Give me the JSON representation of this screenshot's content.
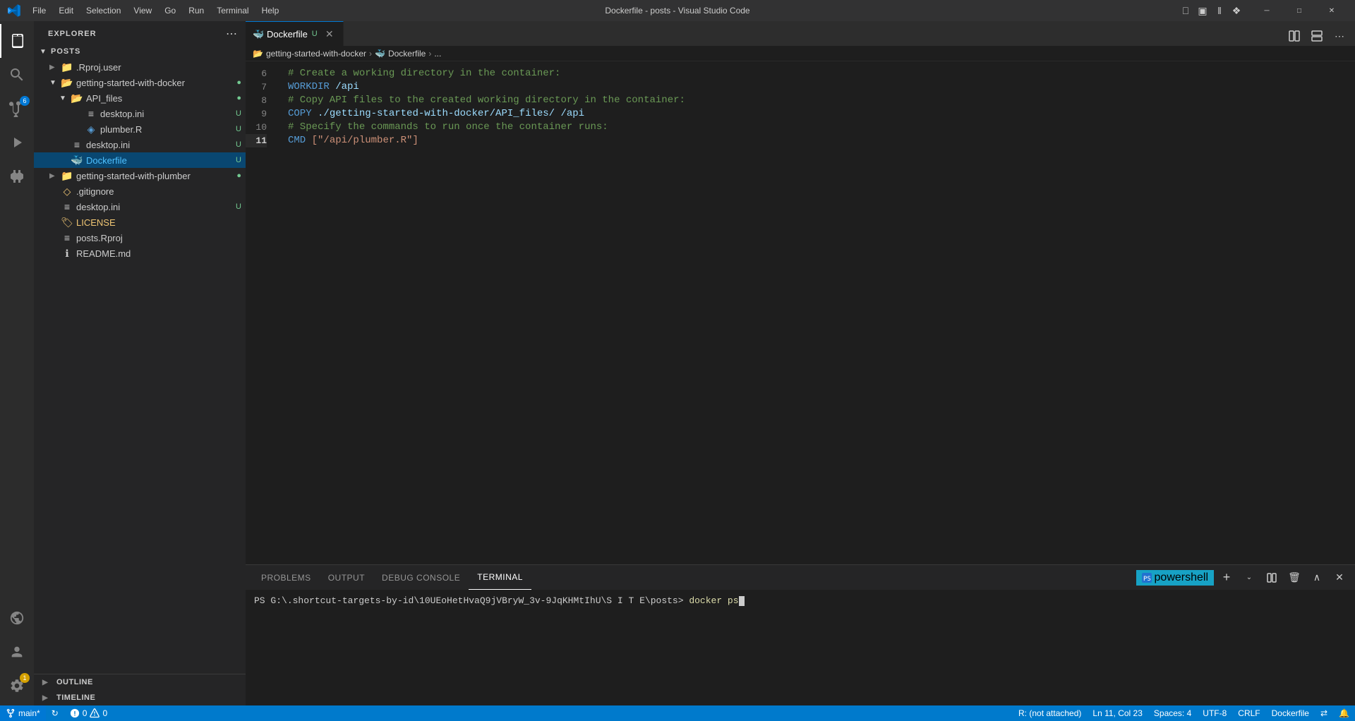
{
  "titleBar": {
    "title": "Dockerfile - posts - Visual Studio Code",
    "menus": [
      "File",
      "Edit",
      "Selection",
      "View",
      "Go",
      "Run",
      "Terminal",
      "Help"
    ]
  },
  "activityBar": {
    "items": [
      {
        "name": "explorer",
        "icon": "📁",
        "active": true
      },
      {
        "name": "search",
        "icon": "🔍",
        "active": false
      },
      {
        "name": "source-control",
        "icon": "⎇",
        "active": false,
        "badge": "6"
      },
      {
        "name": "run-debug",
        "icon": "▷",
        "active": false
      },
      {
        "name": "extensions",
        "icon": "⊞",
        "active": false
      }
    ],
    "bottomItems": [
      {
        "name": "remote-explorer",
        "icon": "⬡",
        "active": false
      },
      {
        "name": "account",
        "icon": "👤",
        "active": false
      },
      {
        "name": "settings",
        "icon": "⚙",
        "active": false,
        "badge": "1"
      }
    ]
  },
  "sidebar": {
    "title": "EXPLORER",
    "root": "POSTS",
    "tree": [
      {
        "label": ".Rproj.user",
        "type": "folder-closed",
        "indent": 1,
        "collapsed": true
      },
      {
        "label": "getting-started-with-docker",
        "type": "folder-open",
        "indent": 1,
        "collapsed": false,
        "status": "●"
      },
      {
        "label": "API_files",
        "type": "folder-open",
        "indent": 2,
        "collapsed": false,
        "status": "●"
      },
      {
        "label": "desktop.ini",
        "type": "file-ini",
        "indent": 3,
        "status": "U"
      },
      {
        "label": "plumber.R",
        "type": "file-r",
        "indent": 3,
        "status": "U"
      },
      {
        "label": "desktop.ini",
        "type": "file-ini",
        "indent": 2,
        "status": "U"
      },
      {
        "label": "Dockerfile",
        "type": "file-dockerfile",
        "indent": 2,
        "status": "U",
        "active": true
      },
      {
        "label": "getting-started-with-plumber",
        "type": "folder-closed",
        "indent": 1,
        "collapsed": true,
        "status": "●"
      },
      {
        "label": ".gitignore",
        "type": "file-gitignore",
        "indent": 1
      },
      {
        "label": "desktop.ini",
        "type": "file-ini",
        "indent": 1,
        "status": "U"
      },
      {
        "label": "LICENSE",
        "type": "file-license",
        "indent": 1
      },
      {
        "label": "posts.Rproj",
        "type": "file-rproj",
        "indent": 1
      },
      {
        "label": "README.md",
        "type": "file-md",
        "indent": 1
      }
    ],
    "bottomSections": [
      "OUTLINE",
      "TIMELINE"
    ]
  },
  "editor": {
    "tab": {
      "name": "Dockerfile",
      "badge": "U",
      "icon": "🐳"
    },
    "breadcrumb": [
      "getting-started-with-docker",
      "Dockerfile",
      "..."
    ],
    "lines": [
      {
        "num": 6,
        "content": [
          {
            "text": "# Create a working directory in the container:",
            "class": "syn-comment"
          }
        ]
      },
      {
        "num": 7,
        "content": [
          {
            "text": "WORKDIR ",
            "class": "syn-keyword"
          },
          {
            "text": "/api",
            "class": "syn-path"
          }
        ]
      },
      {
        "num": 8,
        "content": [
          {
            "text": "# Copy API files to the created working directory in the container:",
            "class": "syn-comment"
          }
        ]
      },
      {
        "num": 9,
        "content": [
          {
            "text": "COPY ",
            "class": "syn-keyword"
          },
          {
            "text": "./getting-started-with-docker/API_files/ /api",
            "class": "syn-path"
          }
        ]
      },
      {
        "num": 10,
        "content": [
          {
            "text": "# Specify the commands to run once the container runs:",
            "class": "syn-comment"
          }
        ]
      },
      {
        "num": 11,
        "content": [
          {
            "text": "CMD ",
            "class": "syn-keyword"
          },
          {
            "text": "[\"/api/plumber.R\"]",
            "class": "syn-string"
          }
        ]
      }
    ]
  },
  "panel": {
    "tabs": [
      "PROBLEMS",
      "OUTPUT",
      "DEBUG CONSOLE",
      "TERMINAL"
    ],
    "activeTab": "TERMINAL",
    "terminalType": "powershell",
    "terminalContent": "PS G:\\.shortcut-targets-by-id\\10UEoHetHvaQ9jVBryW_3v-9JqKHMtIhU\\S I T E\\posts> docker ps"
  },
  "statusBar": {
    "branch": "main*",
    "errors": "0",
    "warnings": "0",
    "position": "Ln 11, Col 23",
    "spaces": "Spaces: 4",
    "encoding": "UTF-8",
    "lineEnding": "CRLF",
    "language": "Dockerfile",
    "remote": "R: (not attached)",
    "syncIcon": "↕",
    "notifyIcon": "🔔"
  }
}
